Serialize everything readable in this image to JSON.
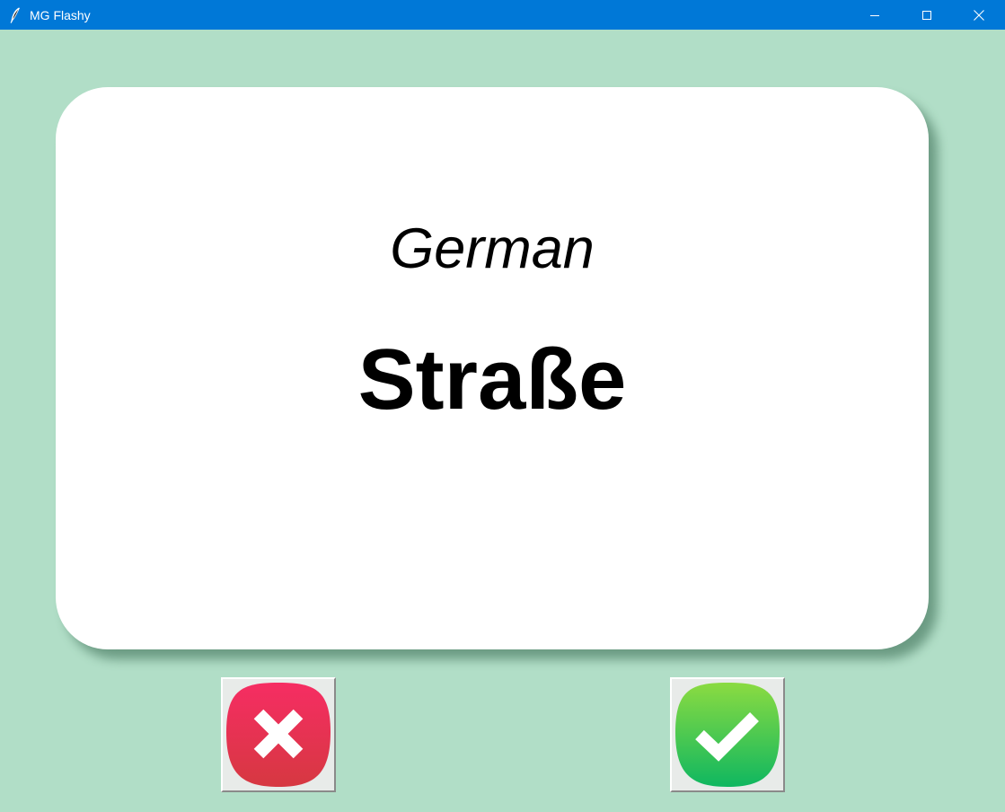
{
  "window": {
    "title": "MG Flashy",
    "app_icon": "feather-icon",
    "controls": [
      "minimize-icon",
      "maximize-icon",
      "close-icon"
    ]
  },
  "colors": {
    "background": "#b1dec7",
    "titlebar": "#0078d7",
    "card": "#ffffff",
    "wrong_button": "#e8314f",
    "right_button": "#22c55e"
  },
  "card": {
    "language": "German",
    "word": "Straße"
  },
  "buttons": {
    "wrong_icon": "x-mark-icon",
    "right_icon": "check-mark-icon"
  }
}
